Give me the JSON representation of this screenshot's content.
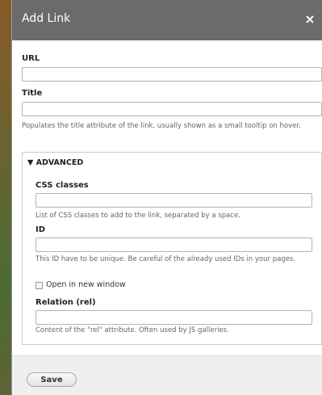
{
  "dialog": {
    "title": "Add Link",
    "close_glyph": "×"
  },
  "url": {
    "label": "URL",
    "value": ""
  },
  "title_field": {
    "label": "Title",
    "value": "",
    "description": "Populates the title attribute of the link, usually shown as a small tooltip on hover."
  },
  "advanced": {
    "legend": "▼ ADVANCED",
    "css_classes": {
      "label": "CSS classes",
      "value": "",
      "description": "List of CSS classes to add to the link, separated by a space."
    },
    "id_field": {
      "label": "ID",
      "value": "",
      "description": "This ID have to be unique. Be careful of the already used IDs in your pages."
    },
    "new_window": {
      "label": "Open in new window",
      "checked": false
    },
    "relation": {
      "label": "Relation (rel)",
      "value": "",
      "description": "Content of the \"rel\" attribute. Often used by JS galleries."
    }
  },
  "footer": {
    "save_label": "Save"
  }
}
